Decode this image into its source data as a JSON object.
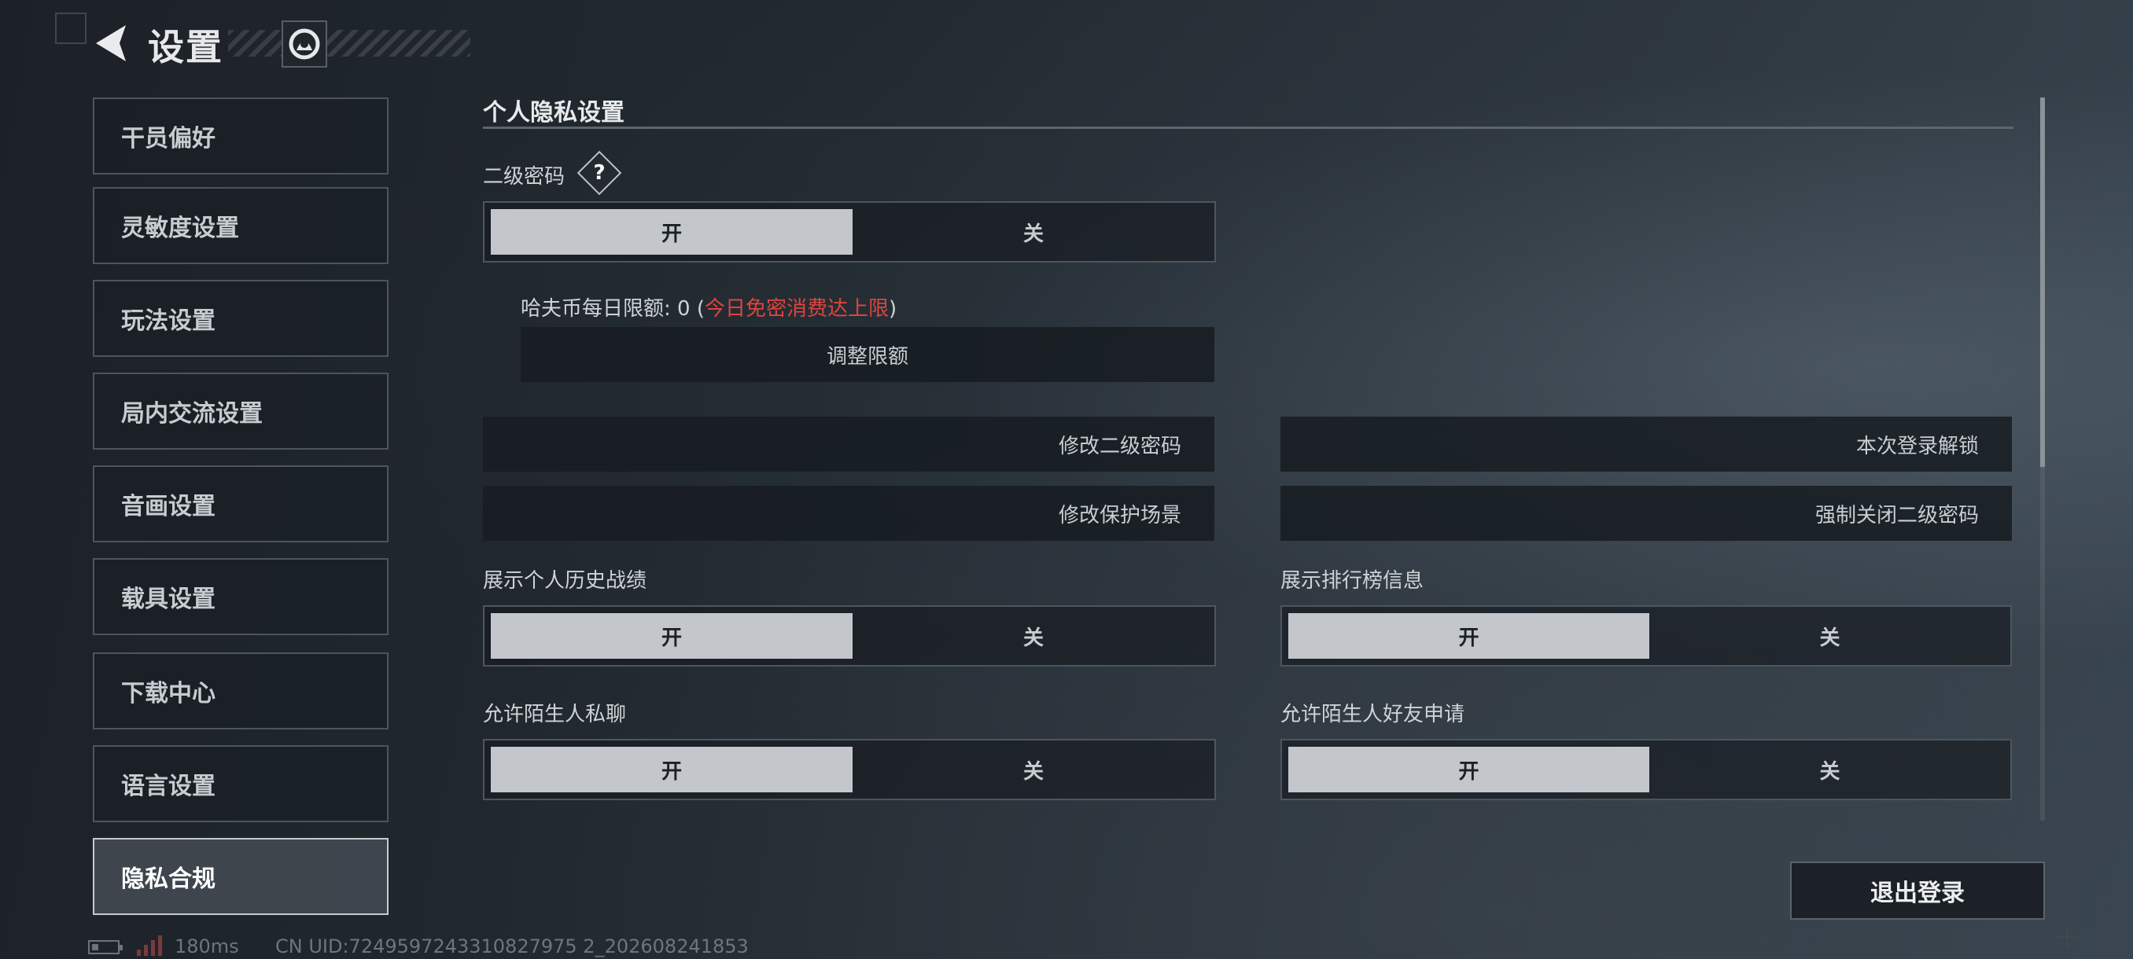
{
  "header": {
    "title": "设置"
  },
  "sidebar": {
    "items": [
      {
        "label": "干员偏好",
        "active": false
      },
      {
        "label": "灵敏度设置",
        "active": false
      },
      {
        "label": "玩法设置",
        "active": false
      },
      {
        "label": "局内交流设置",
        "active": false
      },
      {
        "label": "音画设置",
        "active": false
      },
      {
        "label": "载具设置",
        "active": false
      },
      {
        "label": "下载中心",
        "active": false
      },
      {
        "label": "语言设置",
        "active": false
      },
      {
        "label": "隐私合规",
        "active": true
      }
    ]
  },
  "main": {
    "section_title": "个人隐私设置",
    "secondary_password": {
      "label": "二级密码",
      "help_symbol": "?",
      "on_label": "开",
      "off_label": "关",
      "selected": "on"
    },
    "daily_limit": {
      "prefix": "哈夫币每日限额:",
      "value": "0",
      "open_paren": "(",
      "notice": "今日免密消费达上限",
      "close_paren": ")",
      "adjust_button": "调整限额"
    },
    "actions": {
      "change_password": "修改二级密码",
      "unlock_login": "本次登录解锁",
      "change_scene": "修改保护场景",
      "force_close": "强制关闭二级密码"
    },
    "toggles": [
      {
        "label": "展示个人历史战绩",
        "on_label": "开",
        "off_label": "关",
        "selected": "on"
      },
      {
        "label": "展示排行榜信息",
        "on_label": "开",
        "off_label": "关",
        "selected": "on"
      },
      {
        "label": "允许陌生人私聊",
        "on_label": "开",
        "off_label": "关",
        "selected": "on"
      },
      {
        "label": "允许陌生人好友申请",
        "on_label": "开",
        "off_label": "关",
        "selected": "on"
      }
    ],
    "logout_button": "退出登录"
  },
  "footer": {
    "ping": "180ms",
    "uid": "CN UID:7249597243310827975 2_202608241853"
  },
  "colors": {
    "accent_selected": "#c3c7cb",
    "warning": "#e0443c",
    "active_border": "#c6cbd0"
  },
  "icons": [
    "back-arrow-icon",
    "emblem-icon",
    "question-icon",
    "battery-icon",
    "signal-icon"
  ]
}
